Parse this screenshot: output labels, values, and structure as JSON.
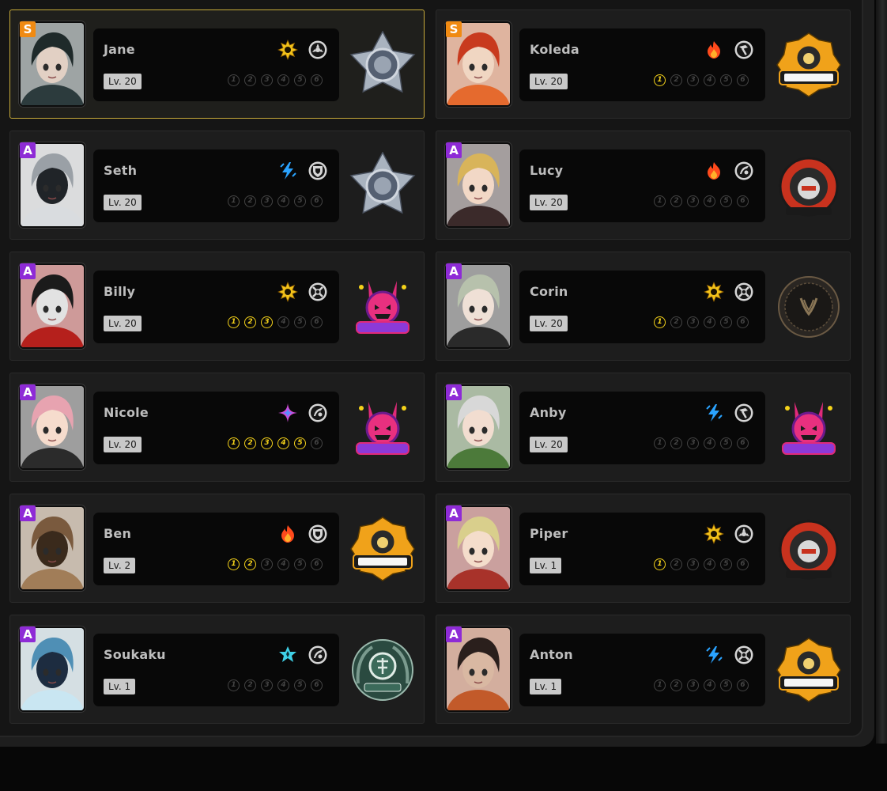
{
  "agents": [
    {
      "name": "Jane",
      "rank": "S",
      "level": "Lv. 20",
      "element": "physical-icon",
      "spec": "anomaly-icon",
      "cinema": 0,
      "faction": "criminal-investigation-badge",
      "selected": true,
      "portrait_colors": [
        "#1f2a2a",
        "#2c3b3d",
        "#e2d0c4"
      ]
    },
    {
      "name": "Koleda",
      "rank": "S",
      "level": "Lv. 20",
      "element": "fire-icon",
      "spec": "stun-icon",
      "cinema": 1,
      "faction": "belobog-badge",
      "selected": false,
      "portrait_colors": [
        "#c83a1e",
        "#e56a2e",
        "#f0d6c2"
      ]
    },
    {
      "name": "Seth",
      "rank": "A",
      "level": "Lv. 20",
      "element": "electric-icon",
      "spec": "defense-icon",
      "cinema": 0,
      "faction": "criminal-investigation-badge",
      "selected": false,
      "portrait_colors": [
        "#9aa0a6",
        "#d9dcdf",
        "#202428"
      ]
    },
    {
      "name": "Lucy",
      "rank": "A",
      "level": "Lv. 20",
      "element": "fire-icon",
      "spec": "support-icon",
      "cinema": 0,
      "faction": "sons-of-calydon-badge",
      "selected": false,
      "portrait_colors": [
        "#d8b45a",
        "#3b2a2a",
        "#f2d8c6"
      ]
    },
    {
      "name": "Billy",
      "rank": "A",
      "level": "Lv. 20",
      "element": "physical-icon",
      "spec": "attack-icon",
      "cinema": 3,
      "faction": "cunning-hares-badge",
      "selected": false,
      "portrait_colors": [
        "#1b1b1b",
        "#b5201c",
        "#e2e2e2"
      ]
    },
    {
      "name": "Corin",
      "rank": "A",
      "level": "Lv. 20",
      "element": "physical-icon",
      "spec": "attack-icon",
      "cinema": 1,
      "faction": "victoria-housekeeping-badge",
      "selected": false,
      "portrait_colors": [
        "#b7c1ac",
        "#2a2a2a",
        "#efe0d6"
      ]
    },
    {
      "name": "Nicole",
      "rank": "A",
      "level": "Lv. 20",
      "element": "ether-icon",
      "spec": "support-icon",
      "cinema": 5,
      "faction": "cunning-hares-badge",
      "selected": false,
      "portrait_colors": [
        "#e7a3b0",
        "#2b2b2b",
        "#f6dccd"
      ]
    },
    {
      "name": "Anby",
      "rank": "A",
      "level": "Lv. 20",
      "element": "electric-icon",
      "spec": "stun-icon",
      "cinema": 0,
      "faction": "cunning-hares-badge",
      "selected": false,
      "portrait_colors": [
        "#d8d8d8",
        "#4c7a3a",
        "#f2ddd0"
      ]
    },
    {
      "name": "Ben",
      "rank": "A",
      "level": "Lv. 2",
      "element": "fire-icon",
      "spec": "defense-icon",
      "cinema": 2,
      "faction": "belobog-badge",
      "selected": false,
      "portrait_colors": [
        "#7a5a3e",
        "#a17d58",
        "#3a2a1c"
      ]
    },
    {
      "name": "Piper",
      "rank": "A",
      "level": "Lv. 1",
      "element": "physical-icon",
      "spec": "anomaly-icon",
      "cinema": 1,
      "faction": "sons-of-calydon-badge",
      "selected": false,
      "portrait_colors": [
        "#d9cf8c",
        "#a8322a",
        "#f4ddcb"
      ]
    },
    {
      "name": "Soukaku",
      "rank": "A",
      "level": "Lv. 1",
      "element": "ice-icon",
      "spec": "support-icon",
      "cinema": 0,
      "faction": "hsos6-badge",
      "selected": false,
      "portrait_colors": [
        "#4f8fb5",
        "#c9e6f2",
        "#1d2c40"
      ]
    },
    {
      "name": "Anton",
      "rank": "A",
      "level": "Lv. 1",
      "element": "electric-icon",
      "spec": "attack-icon",
      "cinema": 0,
      "faction": "belobog-badge",
      "selected": false,
      "portrait_colors": [
        "#2a1f1c",
        "#c25a2a",
        "#d9b8a2"
      ]
    }
  ],
  "cinema_labels": [
    "1",
    "2",
    "3",
    "4",
    "5",
    "6"
  ],
  "colors": {
    "accent_yellow": "#f4d21a",
    "rank_s": "#f08a12",
    "rank_a": "#8e2bd6",
    "selected_border": "#c8ab3a"
  }
}
